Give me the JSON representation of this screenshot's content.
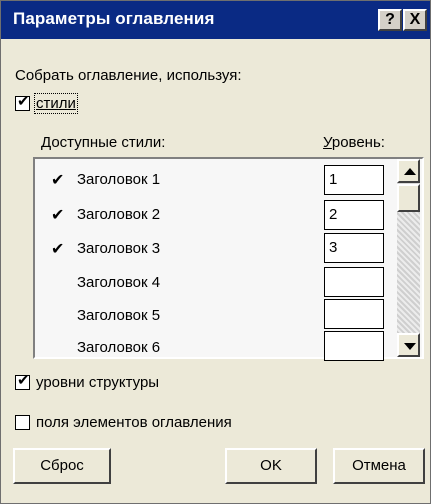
{
  "dialog": {
    "title": "Параметры оглавления",
    "help_label": "?",
    "close_label": "X"
  },
  "collect_label": "Собрать оглавление, используя:",
  "styles_checkbox": {
    "label": "стили",
    "checked": true
  },
  "available_styles_label": "Доступные стили:",
  "level_header": "Уровень:",
  "styles": [
    {
      "name": "Заголовок 1",
      "checked": true,
      "level": "1"
    },
    {
      "name": "Заголовок 2",
      "checked": true,
      "level": "2"
    },
    {
      "name": "Заголовок 3",
      "checked": true,
      "level": "3"
    },
    {
      "name": "Заголовок 4",
      "checked": false,
      "level": ""
    },
    {
      "name": "Заголовок 5",
      "checked": false,
      "level": ""
    },
    {
      "name": "Заголовок 6",
      "checked": false,
      "level": ""
    }
  ],
  "structure_levels": {
    "label": "уровни структуры",
    "checked": true
  },
  "toc_fields": {
    "label": "поля элементов оглавления",
    "checked": false
  },
  "buttons": {
    "reset": "Сброс",
    "ok": "OK",
    "cancel": "Отмена"
  },
  "check_glyph": "✔"
}
